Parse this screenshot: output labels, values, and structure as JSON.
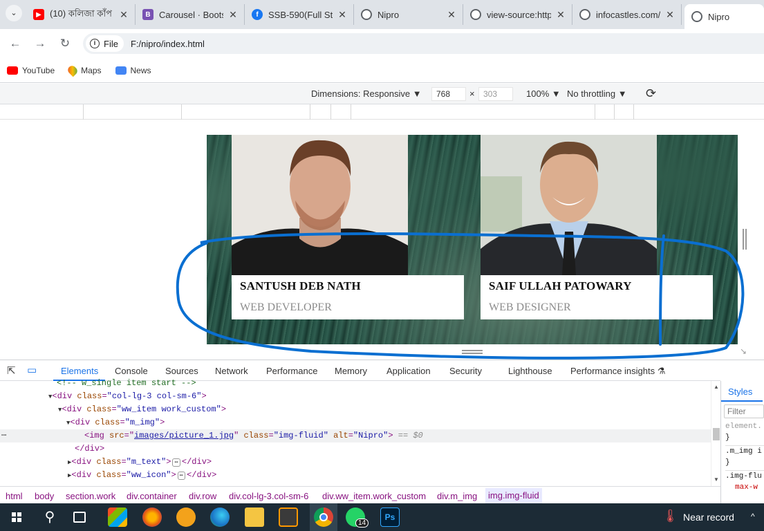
{
  "browser": {
    "tabs": [
      {
        "title": "(10) কলিজা কাঁপ",
        "icon": "youtube-icon",
        "color": "#ff0000"
      },
      {
        "title": "Carousel · Boots",
        "icon": "bootstrap-icon",
        "color": "#7952b3"
      },
      {
        "title": "SSB-590(Full Sta",
        "icon": "facebook-icon",
        "color": "#1877f2"
      },
      {
        "title": "Nipro",
        "icon": "globe-icon",
        "color": "#5f6368"
      },
      {
        "title": "view-source:http",
        "icon": "globe-icon",
        "color": "#5f6368"
      },
      {
        "title": "infocastles.com/",
        "icon": "globe-icon",
        "color": "#5f6368"
      },
      {
        "title": "Nipro",
        "icon": "globe-icon",
        "color": "#5f6368",
        "active": true
      }
    ],
    "address": {
      "scheme_label": "File",
      "url": "F:/nipro/index.html"
    },
    "bookmarks": [
      {
        "label": "YouTube",
        "icon": "youtube-icon"
      },
      {
        "label": "Maps",
        "icon": "maps-icon"
      },
      {
        "label": "News",
        "icon": "news-icon"
      }
    ]
  },
  "device_toolbar": {
    "dimensions_label": "Dimensions: Responsive",
    "width": "768",
    "times": "×",
    "height_placeholder": "303",
    "zoom": "100%",
    "throttling": "No throttling"
  },
  "page": {
    "cards": [
      {
        "name": "SANTUSH DEB NATH",
        "role": "WEB DEVELOPER"
      },
      {
        "name": "SAIF ULLAH PATOWARY",
        "role": "WEB DESIGNER"
      }
    ],
    "annotation_color": "#0a6fd1"
  },
  "devtools": {
    "tabs": [
      "Elements",
      "Console",
      "Sources",
      "Network",
      "Performance",
      "Memory",
      "Application",
      "Security",
      "Lighthouse",
      "Performance insights"
    ],
    "dom": {
      "comment": "<!-- w_single item start -->",
      "l1_tag": "div",
      "l1_attr": "class",
      "l1_val": "\"col-lg-3 col-sm-6\"",
      "l2_tag": "div",
      "l2_attr": "class",
      "l2_val": "\"ww_item work_custom\"",
      "l3_tag": "div",
      "l3_attr": "class",
      "l3_val": "\"m_img\"",
      "img_src": "images/picture_1.jpg",
      "img_class": "\"img-fluid\"",
      "img_alt": "\"Nipro\"",
      "eq0": "== $0",
      "close_div": "</div>",
      "l5_val": "\"m_text\"",
      "l6_val": "\"ww_icon\""
    },
    "breadcrumbs": [
      "html",
      "body",
      "section.work",
      "div.container",
      "div.row",
      "div.col-lg-3.col-sm-6",
      "div.ww_item.work_custom",
      "div.m_img",
      "img.img-fluid"
    ],
    "styles": {
      "tab": "Styles",
      "filter_placeholder": "Filter",
      "rules": [
        "element.",
        "}",
        ".m_img i",
        "}",
        ".img-flu",
        "max-w"
      ]
    }
  },
  "taskbar": {
    "weather": "Near record",
    "whatsapp_badge": "14"
  }
}
